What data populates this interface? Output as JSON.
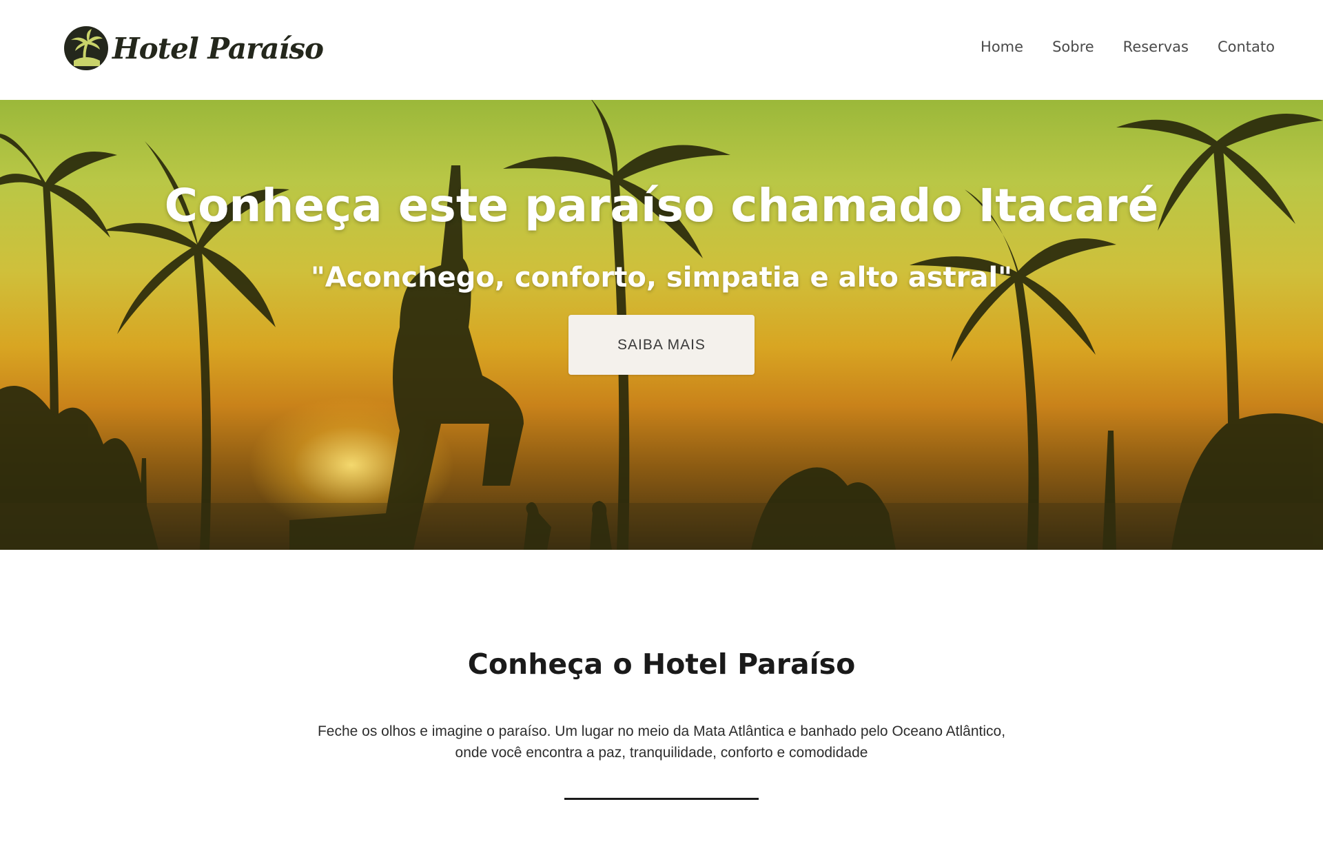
{
  "header": {
    "logo_text": "Hotel Paraíso",
    "nav": [
      {
        "label": "Home"
      },
      {
        "label": "Sobre"
      },
      {
        "label": "Reservas"
      },
      {
        "label": "Contato"
      }
    ]
  },
  "hero": {
    "title": "Conheça este paraíso chamado Itacaré",
    "subtitle": "\"Aconchego, conforto, simpatia e alto astral\"",
    "button_label": "SAIBA MAIS"
  },
  "about": {
    "title": "Conheça o Hotel Paraíso",
    "text_line1": "Feche os olhos e imagine o paraíso. Um lugar no meio da Mata Atlântica e banhado pelo Oceano Atlântico,",
    "text_line2": "onde você encontra a paz, tranquilidade, conforto e comodidade"
  },
  "icons": {
    "logo": "palm-tree-icon"
  },
  "colors": {
    "logo_dark": "#24271c",
    "button_bg": "#f4f1ec",
    "hero_sky": "#b9c746",
    "hero_sunset": "#d8a522"
  }
}
